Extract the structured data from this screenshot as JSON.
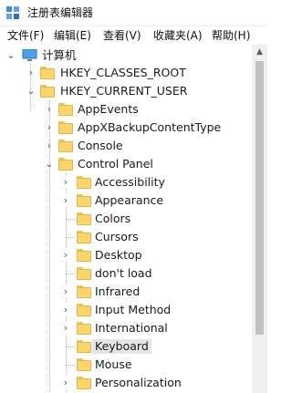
{
  "window": {
    "title": "注册表编辑器",
    "icon": "registry-editor-icon"
  },
  "menu": [
    {
      "label": "文件(F)"
    },
    {
      "label": "编辑(E)"
    },
    {
      "label": "查看(V)"
    },
    {
      "label": "收藏夹(A)"
    },
    {
      "label": "帮助(H)"
    }
  ],
  "tree": {
    "root": {
      "label": "计算机",
      "icon": "computer-icon",
      "expander": "expanded"
    },
    "hives": [
      {
        "label": "HKEY_CLASSES_ROOT",
        "expander": "collapsed"
      },
      {
        "label": "HKEY_CURRENT_USER",
        "expander": "expanded"
      }
    ],
    "current_user_children": [
      {
        "label": "AppEvents",
        "expander": "collapsed"
      },
      {
        "label": "AppXBackupContentType",
        "expander": "collapsed"
      },
      {
        "label": "Console",
        "expander": "collapsed"
      },
      {
        "label": "Control Panel",
        "expander": "expanded"
      }
    ],
    "control_panel_children": [
      {
        "label": "Accessibility",
        "expander": "collapsed"
      },
      {
        "label": "Appearance",
        "expander": "collapsed"
      },
      {
        "label": "Colors",
        "expander": "none"
      },
      {
        "label": "Cursors",
        "expander": "none"
      },
      {
        "label": "Desktop",
        "expander": "collapsed"
      },
      {
        "label": "don't load",
        "expander": "none"
      },
      {
        "label": "Infrared",
        "expander": "collapsed"
      },
      {
        "label": "Input Method",
        "expander": "collapsed"
      },
      {
        "label": "International",
        "expander": "collapsed"
      },
      {
        "label": "Keyboard",
        "expander": "none",
        "selected": true
      },
      {
        "label": "Mouse",
        "expander": "none"
      },
      {
        "label": "Personalization",
        "expander": "collapsed"
      }
    ]
  },
  "colors": {
    "folder": "#fbd46a",
    "selection": "#e5e5e5"
  }
}
